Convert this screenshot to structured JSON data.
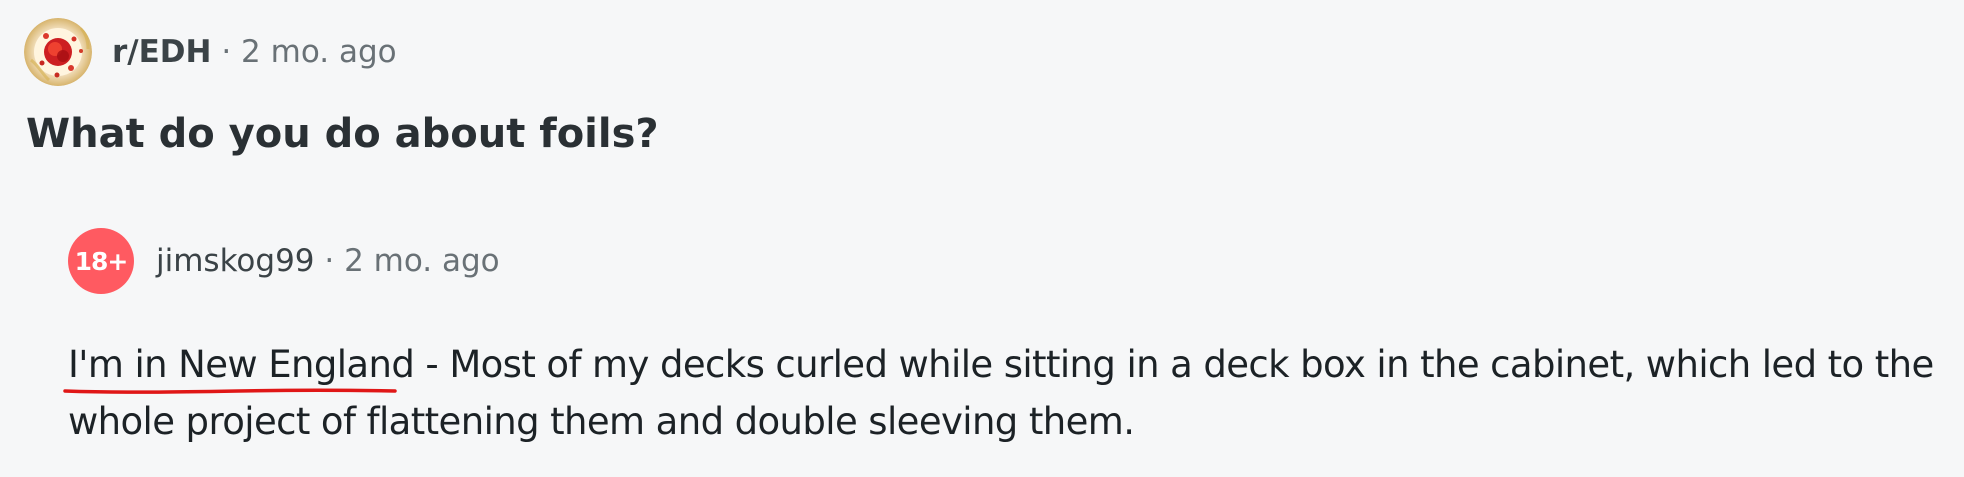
{
  "post": {
    "subreddit": "r/EDH",
    "separator": "·",
    "time": "2 mo. ago",
    "title": "What do you do about foils?",
    "subreddit_icon": "subreddit-avatar-icon"
  },
  "comment": {
    "avatar_label": "18+",
    "author": "jimskog99",
    "separator": "·",
    "time": "2 mo. ago",
    "body_highlight": "I'm in New England",
    "body_rest": " - Most of my decks curled while sitting in a deck box in the cabinet, which led to the whole project of flattening them and double sleeving them."
  },
  "colors": {
    "background": "#f6f7f8",
    "nsfw_avatar": "#ff5a61",
    "underline": "#e01717",
    "meta_text": "#697176"
  }
}
